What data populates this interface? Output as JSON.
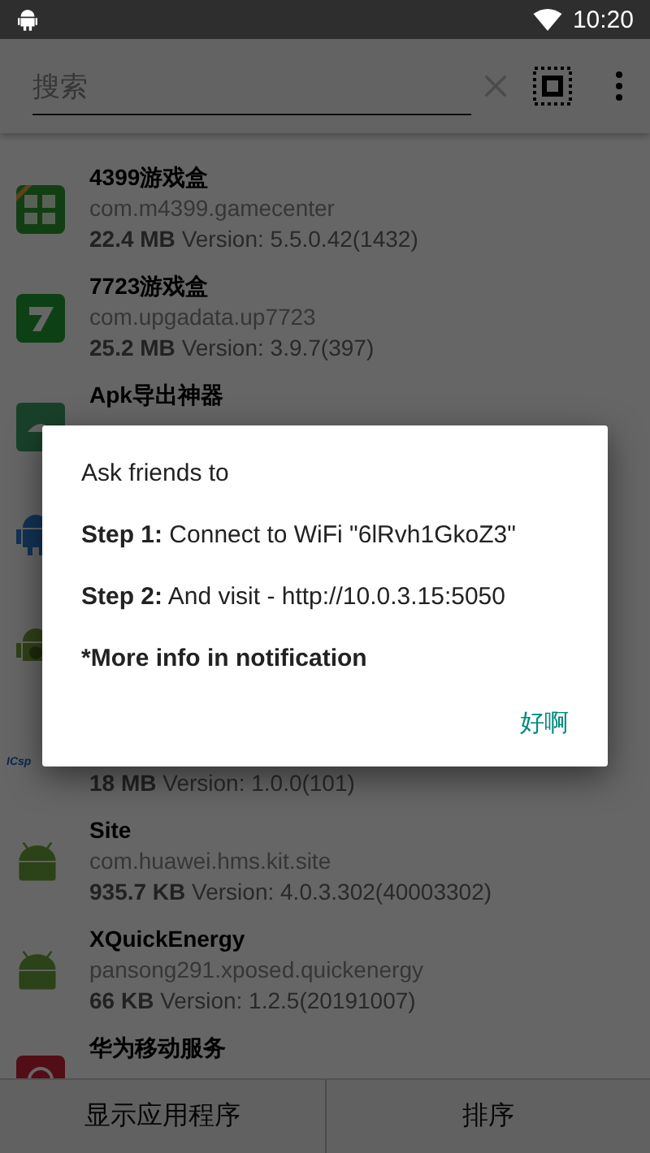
{
  "status_bar": {
    "time": "10:20"
  },
  "search": {
    "placeholder": "搜索"
  },
  "apps": [
    {
      "kind": "game-box",
      "name": "4399游戏盒",
      "package": "com.m4399.gamecenter",
      "size": "22.4 MB",
      "version": "Version: 5.5.0.42(1432)"
    },
    {
      "kind": "seven",
      "name": "7723游戏盒",
      "package": "com.upgadata.up7723",
      "size": "25.2 MB",
      "version": "Version: 3.9.7(397)"
    },
    {
      "kind": "export",
      "name": "Apk导出神器"
    },
    {
      "kind": "android-blue"
    },
    {
      "kind": "android-gear"
    },
    {
      "kind": "logo-text",
      "logo_text": "ICsp",
      "size": "18 MB",
      "version": "Version: 1.0.0(101)"
    },
    {
      "kind": "android",
      "name": "Site",
      "package": "com.huawei.hms.kit.site",
      "size": "935.7 KB",
      "version": "Version: 4.0.3.302(40003302)"
    },
    {
      "kind": "android",
      "name": "XQuickEnergy",
      "package": "pansong291.xposed.quickenergy",
      "size": "66 KB",
      "version": "Version: 1.2.5(20191007)"
    },
    {
      "kind": "red-square",
      "name": "华为移动服务"
    }
  ],
  "bottom_buttons": [
    "显示应用程序",
    "排序"
  ],
  "dialog": {
    "lines": [
      {
        "kind": "plain",
        "text": "Ask friends to"
      },
      {
        "kind": "rich",
        "text": "**Step 1:** Connect to WiFi \"6lRvh1GkoZ3\""
      },
      {
        "kind": "rich",
        "text": "**Step 2:** And visit - http://10.0.3.15:5050"
      },
      {
        "kind": "note",
        "text": "*More info in notification"
      }
    ],
    "button": "好啊"
  }
}
